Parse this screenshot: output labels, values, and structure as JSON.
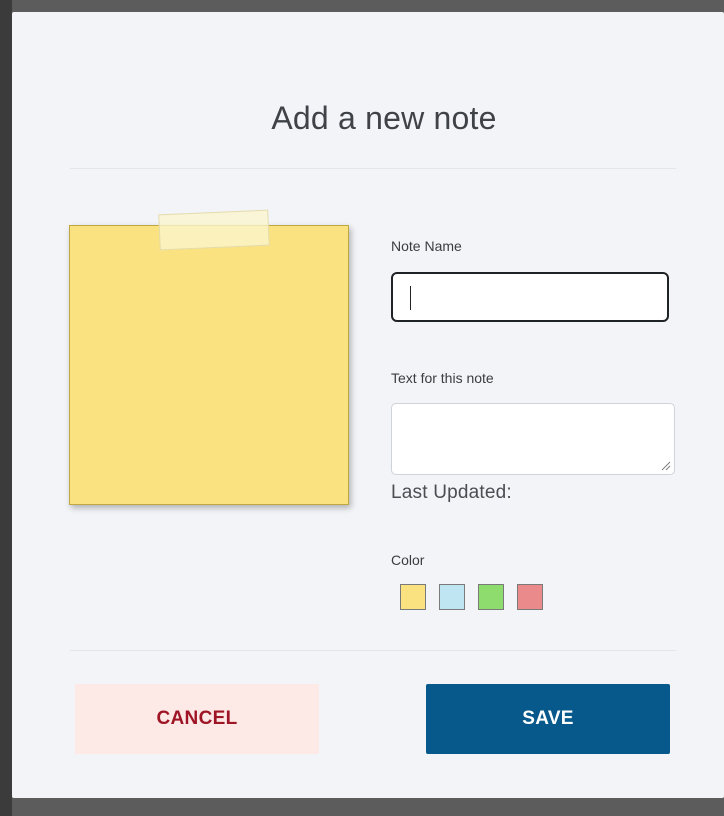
{
  "modal": {
    "title": "Add a new note"
  },
  "form": {
    "name_label": "Note Name",
    "name_value": "",
    "text_label": "Text for this note",
    "text_value": "",
    "last_updated_label": "Last Updated:",
    "color_label": "Color"
  },
  "note_preview": {
    "color": "#f9e27f"
  },
  "colors": [
    {
      "name": "yellow",
      "hex": "#f9e27f"
    },
    {
      "name": "light-blue",
      "hex": "#bfe4f2"
    },
    {
      "name": "green",
      "hex": "#8fdc6e"
    },
    {
      "name": "red",
      "hex": "#eb8a8a"
    }
  ],
  "actions": {
    "cancel_label": "CANCEL",
    "save_label": "SAVE",
    "cancel_text_color": "#9e1626",
    "save_bg_color": "#06598a"
  }
}
